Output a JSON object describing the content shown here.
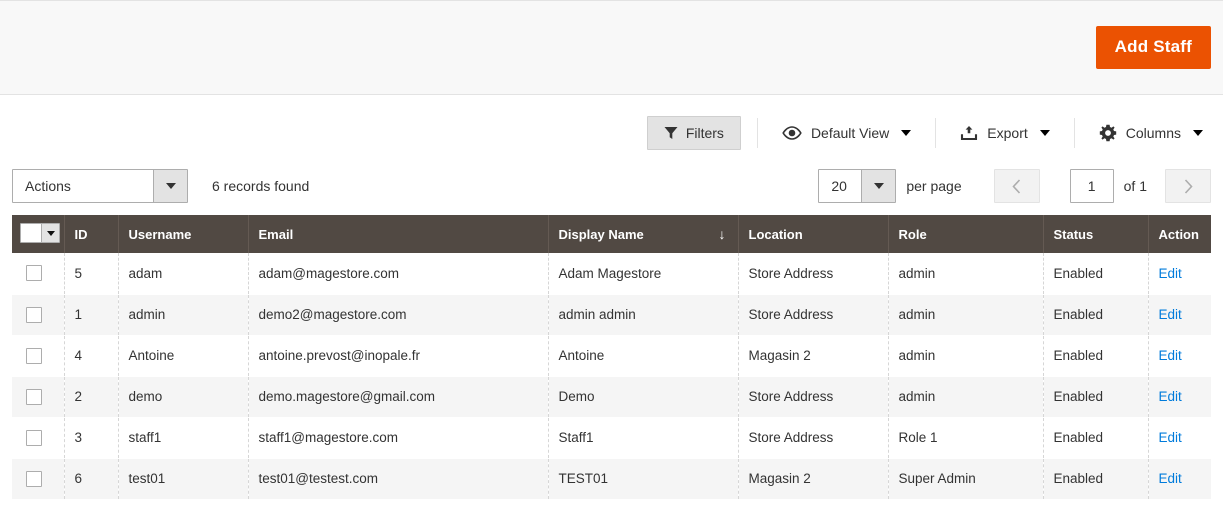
{
  "page_actions": {
    "add_staff_label": "Add Staff",
    "primary_color": "#eb5202"
  },
  "toolbar": {
    "filters_label": "Filters",
    "default_view_label": "Default View",
    "export_label": "Export",
    "columns_label": "Columns",
    "actions_label": "Actions",
    "records_found": "6 records found",
    "per_page_value": "20",
    "per_page_label": "per page",
    "page_value": "1",
    "page_of": "of 1",
    "prev_icon": "chevron-left",
    "next_icon": "chevron-right"
  },
  "grid": {
    "columns": [
      {
        "key": "check",
        "label": ""
      },
      {
        "key": "id",
        "label": "ID"
      },
      {
        "key": "user",
        "label": "Username"
      },
      {
        "key": "email",
        "label": "Email"
      },
      {
        "key": "display",
        "label": "Display Name"
      },
      {
        "key": "loc",
        "label": "Location"
      },
      {
        "key": "role",
        "label": "Role"
      },
      {
        "key": "status",
        "label": "Status"
      },
      {
        "key": "action",
        "label": "Action"
      }
    ],
    "sorted_column": "Display Name",
    "sort_direction_glyph": "↓",
    "action_link_label": "Edit",
    "action_link_color": "#007bdb",
    "header_bg": "#514943",
    "rows": [
      {
        "id": "5",
        "username": "adam",
        "email": "adam@magestore.com",
        "display_name": "Adam Magestore",
        "location": "Store Address",
        "role": "admin",
        "status": "Enabled",
        "action": "Edit"
      },
      {
        "id": "1",
        "username": "admin",
        "email": "demo2@magestore.com",
        "display_name": "admin admin",
        "location": "Store Address",
        "role": "admin",
        "status": "Enabled",
        "action": "Edit"
      },
      {
        "id": "4",
        "username": "Antoine",
        "email": "antoine.prevost@inopale.fr",
        "display_name": "Antoine",
        "location": "Magasin 2",
        "role": "admin",
        "status": "Enabled",
        "action": "Edit"
      },
      {
        "id": "2",
        "username": "demo",
        "email": "demo.magestore@gmail.com",
        "display_name": "Demo",
        "location": "Store Address",
        "role": "admin",
        "status": "Enabled",
        "action": "Edit"
      },
      {
        "id": "3",
        "username": "staff1",
        "email": "staff1@magestore.com",
        "display_name": "Staff1",
        "location": "Store Address",
        "role": "Role 1",
        "status": "Enabled",
        "action": "Edit"
      },
      {
        "id": "6",
        "username": "test01",
        "email": "test01@testest.com",
        "display_name": "TEST01",
        "location": "Magasin 2",
        "role": "Super Admin",
        "status": "Enabled",
        "action": "Edit"
      }
    ]
  }
}
